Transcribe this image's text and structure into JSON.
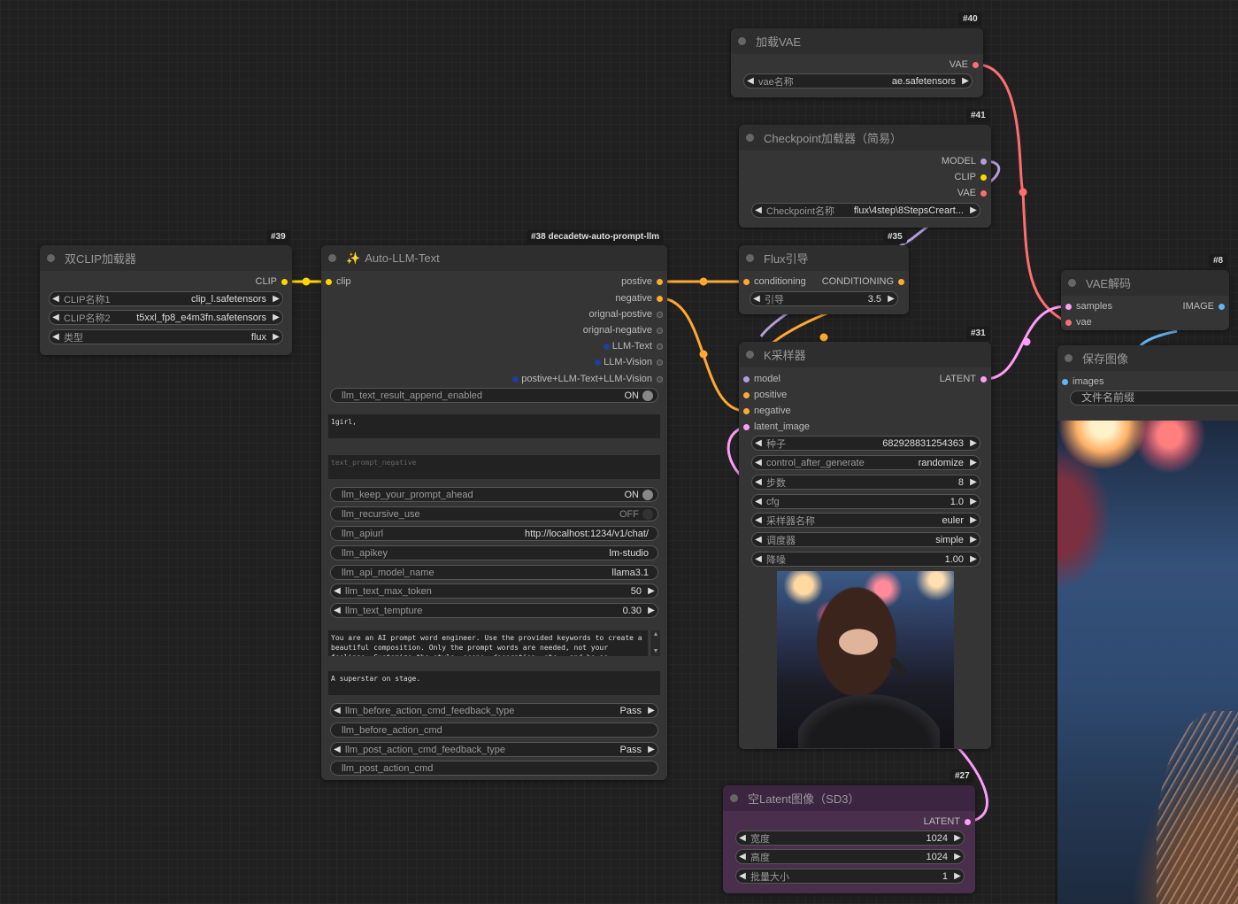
{
  "accent_colors": {
    "clip": "#ffd500",
    "conditioning": "#ffa931",
    "latent": "#ff9cf9",
    "vae": "#ff6e6e",
    "image": "#64b5f6",
    "model": "#b39ddb"
  },
  "nodes": {
    "n39": {
      "id": "#39",
      "title": "双CLIP加载器",
      "output": "CLIP",
      "widgets": [
        {
          "label": "CLIP名称1",
          "value": "clip_l.safetensors"
        },
        {
          "label": "CLIP名称2",
          "value": "t5xxl_fp8_e4m3fn.safetensors"
        },
        {
          "label": "类型",
          "value": "flux"
        }
      ]
    },
    "n38": {
      "id": "#38 decadetw-auto-prompt-llm",
      "icon": "sparkles-icon",
      "title": "Auto-LLM-Text",
      "input": "clip",
      "outputs": [
        "postive",
        "negative",
        "orignal-postive",
        "orignal-negative",
        "LLM-Text",
        "LLM-Vision",
        "postive+LLM-Text+LLM-Vision"
      ],
      "append_toggle": {
        "label": "llm_text_result_append_enabled",
        "value": "ON"
      },
      "text_prompt": "1girl,",
      "text_prompt_negative_placeholder": "text_prompt_negative",
      "settings": [
        {
          "label": "llm_keep_your_prompt_ahead",
          "value": "ON",
          "type": "toggle"
        },
        {
          "label": "llm_recursive_use",
          "value": "OFF",
          "type": "toggle"
        },
        {
          "label": "llm_apiurl",
          "value": "http://localhost:1234/v1/chat/",
          "type": "text"
        },
        {
          "label": "llm_apikey",
          "value": "lm-studio",
          "type": "text"
        },
        {
          "label": "llm_api_model_name",
          "value": "llama3.1",
          "type": "text"
        },
        {
          "label": "llm_text_max_token",
          "value": "50",
          "type": "number"
        },
        {
          "label": "llm_text_tempture",
          "value": "0.30",
          "type": "number"
        }
      ],
      "system_prompt": "You are an AI prompt word engineer. Use the provided keywords to create a beautiful composition. Only the prompt words are needed, not your feelings. Customize the style, scene, decoration, etc., and be as",
      "user_prompt": "A superstar on stage.",
      "actions": [
        {
          "label": "llm_before_action_cmd_feedback_type",
          "value": "Pass",
          "type": "combo"
        },
        {
          "label": "llm_before_action_cmd",
          "value": "",
          "type": "text"
        },
        {
          "label": "llm_post_action_cmd_feedback_type",
          "value": "Pass",
          "type": "combo"
        },
        {
          "label": "llm_post_action_cmd",
          "value": "",
          "type": "text"
        }
      ]
    },
    "n40": {
      "id": "#40",
      "title": "加载VAE",
      "output": "VAE",
      "widget": {
        "label": "vae名称",
        "value": "ae.safetensors"
      }
    },
    "n41": {
      "id": "#41",
      "title": "Checkpoint加载器（简易）",
      "outputs": [
        "MODEL",
        "CLIP",
        "VAE"
      ],
      "widget": {
        "label": "Checkpoint名称",
        "value": "flux\\4step\\8StepsCreart..."
      }
    },
    "n35": {
      "id": "#35",
      "title": "Flux引导",
      "input": "conditioning",
      "output": "CONDITIONING",
      "widget": {
        "label": "引导",
        "value": "3.5"
      }
    },
    "n31": {
      "id": "#31",
      "title": "K采样器",
      "inputs": [
        "model",
        "positive",
        "negative",
        "latent_image"
      ],
      "output": "LATENT",
      "widgets": [
        {
          "label": "种子",
          "value": "682928831254363"
        },
        {
          "label": "control_after_generate",
          "value": "randomize"
        },
        {
          "label": "步数",
          "value": "8"
        },
        {
          "label": "cfg",
          "value": "1.0"
        },
        {
          "label": "采样器名称",
          "value": "euler"
        },
        {
          "label": "调度器",
          "value": "simple"
        },
        {
          "label": "降噪",
          "value": "1.00"
        }
      ]
    },
    "n8": {
      "id": "#8",
      "title": "VAE解码",
      "inputs": [
        "samples",
        "vae"
      ],
      "output": "IMAGE"
    },
    "save": {
      "title": "保存图像",
      "input": "images",
      "filename_label": "文件名前缀"
    },
    "n27": {
      "id": "#27",
      "title": "空Latent图像（SD3）",
      "output": "LATENT",
      "widgets": [
        {
          "label": "宽度",
          "value": "1024"
        },
        {
          "label": "高度",
          "value": "1024"
        },
        {
          "label": "批量大小",
          "value": "1"
        }
      ]
    }
  }
}
